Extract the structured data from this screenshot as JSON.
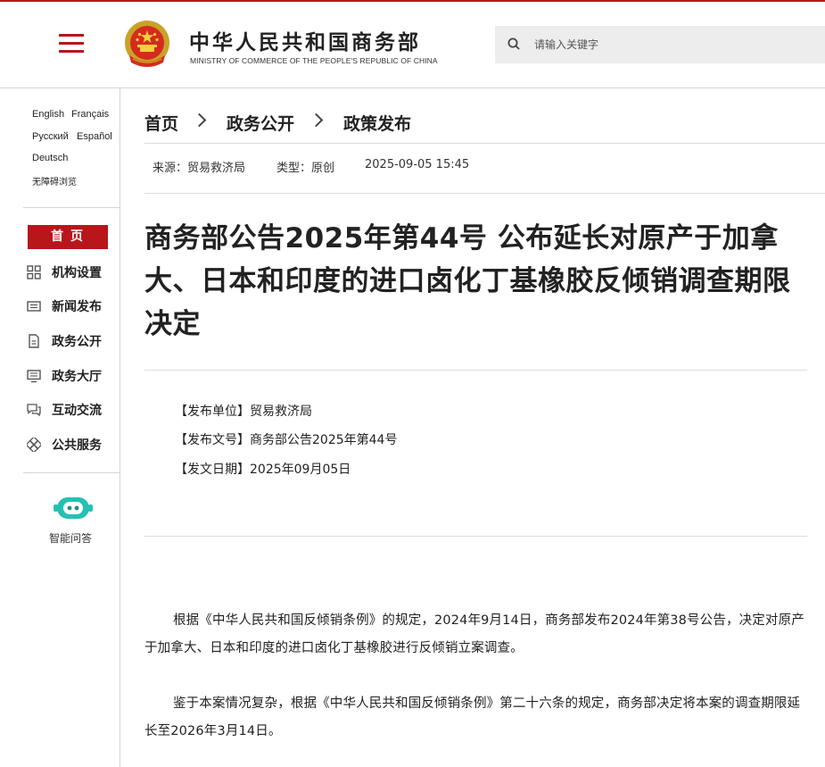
{
  "header": {
    "site_title": "中华人民共和国商务部",
    "site_subtitle": "MINISTRY OF COMMERCE OF THE PEOPLE'S REPUBLIC OF CHINA",
    "search_placeholder": "请输入关键字",
    "accent_color": "#b8161b"
  },
  "sidebar": {
    "languages": [
      "English",
      "Français",
      "Русский",
      "Español",
      "Deutsch",
      "无障碍浏览"
    ],
    "home_label": "首页",
    "nav_items": [
      {
        "label": "机构设置",
        "icon": "org-grid-icon"
      },
      {
        "label": "新闻发布",
        "icon": "newspaper-icon"
      },
      {
        "label": "政务公开",
        "icon": "document-icon"
      },
      {
        "label": "政务大厅",
        "icon": "monitor-icon"
      },
      {
        "label": "互动交流",
        "icon": "chat-icon"
      },
      {
        "label": "公共服务",
        "icon": "service-icon"
      }
    ],
    "assistant_label": "智能问答"
  },
  "breadcrumb": [
    "首页",
    "政务公开",
    "政策发布"
  ],
  "meta": {
    "source": "来源：贸易救济局",
    "type": "类型：原创",
    "datetime": "2025-09-05 15:45"
  },
  "article": {
    "title": "商务部公告2025年第44号 公布延长对原产于加拿大、日本和印度的进口卤化丁基橡胶反倾销调查期限决定",
    "info": [
      "【发布单位】贸易救济局",
      "【发布文号】商务部公告2025年第44号",
      "【发文日期】2025年09月05日"
    ],
    "paragraphs": [
      "根据《中华人民共和国反倾销条例》的规定，2024年9月14日，商务部发布2024年第38号公告，决定对原产于加拿大、日本和印度的进口卤化丁基橡胶进行反倾销立案调查。",
      "鉴于本案情况复杂，根据《中华人民共和国反倾销条例》第二十六条的规定，商务部决定将本案的调查期限延长至2026年3月14日。"
    ]
  }
}
